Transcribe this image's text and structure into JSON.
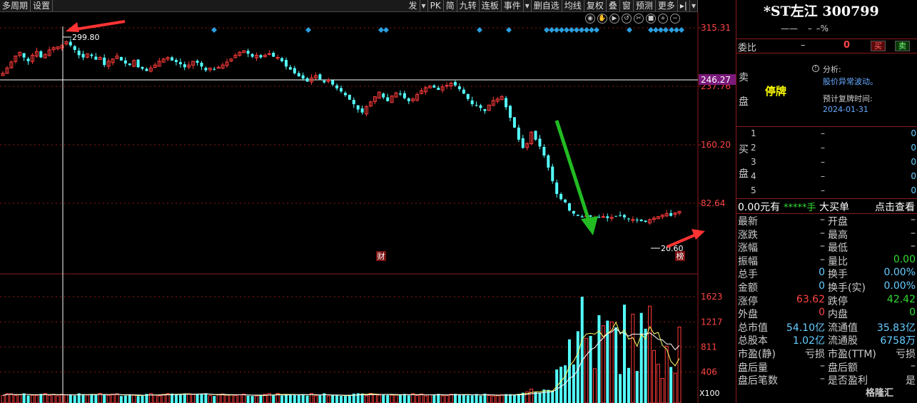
{
  "toolbar": {
    "left": [
      "多周期",
      "设置"
    ],
    "right": [
      "发",
      "PK",
      "简",
      "九转",
      "连板",
      "事件",
      "删自选",
      "均线",
      "复权",
      "叠",
      "窗",
      "预测",
      "更多"
    ],
    "icons": [
      "eye-icon",
      "hand-icon",
      "play-icon",
      "refresh-icon",
      "scissors-icon",
      "lock-icon",
      "zoom-in-icon",
      "zoom-out-icon"
    ]
  },
  "chart_data": {
    "type": "candlestick",
    "price_ticks": [
      "315.31",
      "237.76",
      "160.20",
      "82.64"
    ],
    "current_price_label": "246.27",
    "high_label": "299.80",
    "low_label": "20.60",
    "event_markers": [
      "财",
      "榜"
    ],
    "volume_ticks": [
      "1623",
      "1217",
      "811",
      "406"
    ],
    "volume_unit": "X100",
    "colors": {
      "up": "#ff3b3b",
      "down": "#54ffff",
      "ma": "#ffff66",
      "ma2": "#ffffff",
      "grid": "#8b1a1a",
      "diamond": "#2b9fe0",
      "arrow_red": "#ff3333",
      "arrow_green": "#22bb22"
    }
  },
  "panel": {
    "title": "*ST左江  300799",
    "sub_value": "——",
    "sub_change": "–",
    "sub_pct": "–%",
    "weibi_label": "委比",
    "weibi_v1": "–",
    "weibi_v2": "0",
    "buy_btn": "买",
    "sell_btn": "卖",
    "sell_label_1": "卖",
    "sell_label_2": "盘",
    "suspended": "停牌",
    "info_icon": "!",
    "analysis_label": "分析:",
    "analysis_text": "股价异常波动。",
    "resume_label": "预计复牌时间:",
    "resume_date": "2024-01-31",
    "buy_label_1": "买",
    "buy_label_2": "盘",
    "buy_rows": [
      {
        "n": "1",
        "p": "–",
        "q": "0"
      },
      {
        "n": "2",
        "p": "–",
        "q": "0"
      },
      {
        "n": "3",
        "p": "–",
        "q": "0"
      },
      {
        "n": "4",
        "p": "–",
        "q": "0"
      },
      {
        "n": "5",
        "p": "–",
        "q": "0"
      }
    ],
    "big_amount": "0.00元有",
    "big_stars": "*****手",
    "big_label": "大买单",
    "big_link": "点击查看",
    "quote_rows": [
      {
        "l1": "最新",
        "v1": "–",
        "l2": "开盘",
        "v2": "–",
        "c1": "#ccc",
        "c2": "#ccc"
      },
      {
        "l1": "涨跌",
        "v1": "–",
        "l2": "最高",
        "v2": "–",
        "c1": "#ccc",
        "c2": "#ccc"
      },
      {
        "l1": "涨幅",
        "v1": "–",
        "l2": "最低",
        "v2": "–",
        "c1": "#ccc",
        "c2": "#ccc"
      },
      {
        "l1": "振幅",
        "v1": "–",
        "l2": "量比",
        "v2": "0.00",
        "c1": "#ccc",
        "c2": "#33dd33"
      },
      {
        "l1": "总手",
        "v1": "0",
        "l2": "换手",
        "v2": "0.00%",
        "c1": "#66ccff",
        "c2": "#66ccff"
      },
      {
        "l1": "金额",
        "v1": "0",
        "l2": "换手(实)",
        "v2": "0.00%",
        "c1": "#66ccff",
        "c2": "#66ccff"
      },
      {
        "l1": "涨停",
        "v1": "63.62",
        "l2": "跌停",
        "v2": "42.42",
        "c1": "#ff4444",
        "c2": "#33dd33"
      },
      {
        "l1": "外盘",
        "v1": "0",
        "l2": "内盘",
        "v2": "0",
        "c1": "#ff4444",
        "c2": "#33dd33"
      },
      {
        "l1": "总市值",
        "v1": "54.10亿",
        "l2": "流通值",
        "v2": "35.83亿",
        "c1": "#66ccff",
        "c2": "#66ccff"
      },
      {
        "l1": "总股本",
        "v1": "1.02亿",
        "l2": "流通股",
        "v2": "6758万",
        "c1": "#66ccff",
        "c2": "#66ccff"
      },
      {
        "l1": "市盈(静)",
        "v1": "亏损",
        "l2": "市盈(TTM)",
        "v2": "亏损",
        "c1": "#ccc",
        "c2": "#ccc"
      },
      {
        "l1": "盘后量",
        "v1": "–",
        "l2": "盘后额",
        "v2": "–",
        "c1": "#ccc",
        "c2": "#ccc"
      },
      {
        "l1": "盘后笔数",
        "v1": "–",
        "l2": "是否盈利",
        "v2": "是",
        "c1": "#ccc",
        "c2": "#ccc"
      }
    ]
  },
  "logo": "格隆汇"
}
